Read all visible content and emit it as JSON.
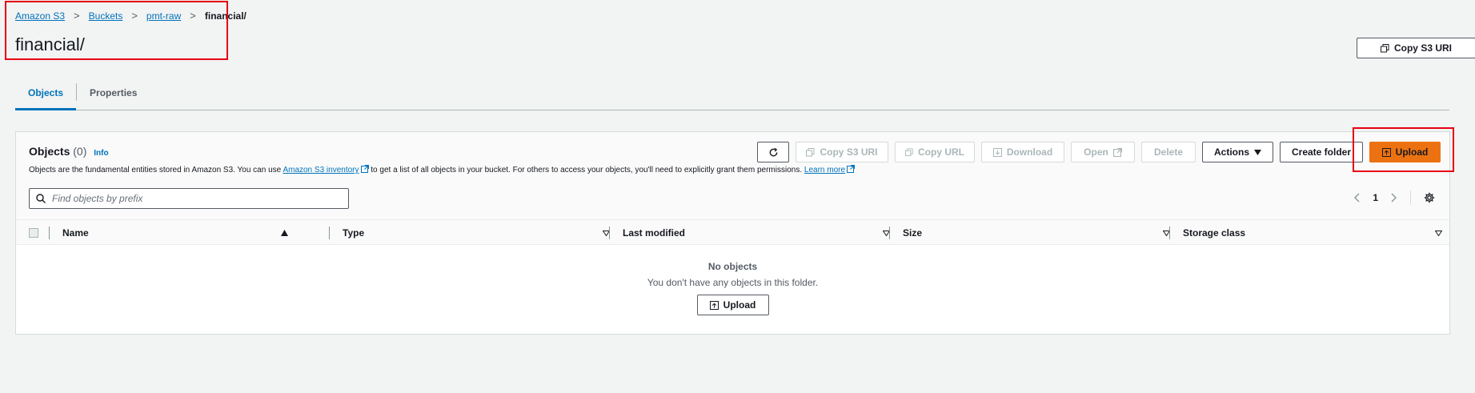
{
  "breadcrumb": {
    "items": [
      "Amazon S3",
      "Buckets",
      "pmt-raw"
    ],
    "current": "financial/"
  },
  "page": {
    "title": "financial/",
    "copy_s3_uri_label": "Copy S3 URI"
  },
  "tabs": [
    {
      "label": "Objects",
      "active": true
    },
    {
      "label": "Properties",
      "active": false
    }
  ],
  "objects_panel": {
    "title": "Objects",
    "count": "(0)",
    "info_label": "Info",
    "description_pre": "Objects are the fundamental entities stored in Amazon S3. You can use",
    "inventory_link": "Amazon S3 inventory",
    "description_mid": "to get a list of all objects in your bucket. For others to access your objects, you'll need to explicitly grant them permissions.",
    "learn_more": "Learn more"
  },
  "toolbar": {
    "copy_s3_uri": "Copy S3 URI",
    "copy_url": "Copy URL",
    "download": "Download",
    "open": "Open",
    "delete": "Delete",
    "actions": "Actions",
    "create_folder": "Create folder",
    "upload": "Upload"
  },
  "search": {
    "placeholder": "Find objects by prefix"
  },
  "pagination": {
    "page": "1"
  },
  "table": {
    "columns": [
      "Name",
      "Type",
      "Last modified",
      "Size",
      "Storage class"
    ]
  },
  "empty_state": {
    "title": "No objects",
    "description": "You don't have any objects in this folder.",
    "upload_label": "Upload"
  },
  "icons": {
    "refresh": "refresh-icon",
    "copy": "copy-icon",
    "download": "download-icon",
    "external": "external-link-icon",
    "upload": "upload-icon",
    "search": "search-icon",
    "settings": "gear-icon"
  },
  "colors": {
    "primary_button": "#ec7211",
    "link": "#0073bb",
    "highlight": "#e60012"
  }
}
